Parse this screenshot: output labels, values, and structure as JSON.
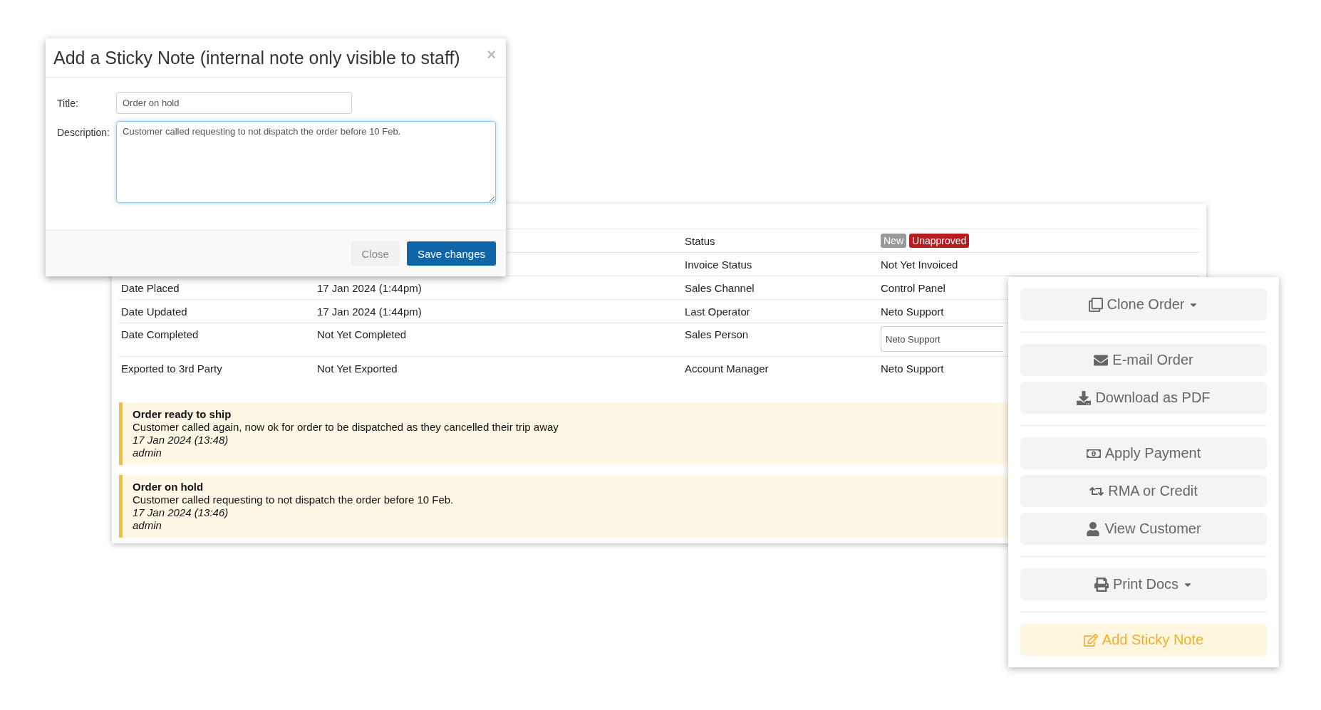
{
  "order_details": {
    "rows": [
      {
        "label_2": "Status",
        "badges": [
          {
            "text": "New",
            "color": "#999999"
          },
          {
            "text": "Unapproved",
            "color": "#b81c23"
          }
        ]
      },
      {
        "label_2": "Invoice Status",
        "value_2": "Not Yet Invoiced"
      },
      {
        "label_1": "Date Placed",
        "value_1": "17 Jan 2024 (1:44pm)",
        "label_2": "Sales Channel",
        "value_2": "Control Panel"
      },
      {
        "label_1": "Date Updated",
        "value_1": "17 Jan 2024 (1:44pm)",
        "label_2": "Last Operator",
        "value_2": "Neto Support"
      },
      {
        "label_1": "Date Completed",
        "value_1": "Not Yet Completed",
        "label_2": "Sales Person",
        "select": "Neto Support"
      },
      {
        "label_1": "Exported to 3rd Party",
        "value_1": "Not Yet Exported",
        "label_2": "Account Manager",
        "value_2": "Neto Support"
      }
    ],
    "notes": [
      {
        "title": "Order ready to ship",
        "text": "Customer called again, now ok for order to be dispatched as they cancelled their trip away",
        "date": "17 Jan 2024 (13:48)",
        "author": "admin"
      },
      {
        "title": "Order on hold",
        "text": "Customer called requesting to not dispatch the order before 10 Feb.",
        "date": "17 Jan 2024 (13:46)",
        "author": "admin"
      }
    ]
  },
  "actions": [
    [
      {
        "label": "Clone Order",
        "dropdown": true,
        "kind": "default"
      }
    ],
    [
      {
        "label": "E-mail Order",
        "dropdown": false,
        "kind": "default"
      },
      {
        "label": "Download as PDF",
        "dropdown": false,
        "kind": "default"
      }
    ],
    [
      {
        "label": "Apply Payment",
        "dropdown": false,
        "kind": "default"
      },
      {
        "label": "RMA or Credit",
        "dropdown": false,
        "kind": "default"
      },
      {
        "label": "View Customer",
        "dropdown": false,
        "kind": "default"
      }
    ],
    [
      {
        "label": "Print Docs",
        "dropdown": true,
        "kind": "default"
      }
    ],
    [
      {
        "label": "Add Sticky Note",
        "dropdown": false,
        "kind": "warning"
      }
    ]
  ],
  "modal": {
    "title": "Add a Sticky Note (internal note only visible to staff)",
    "close": "×",
    "fields": [
      {
        "label": "Title:",
        "value": "Order on hold",
        "kind": "input"
      },
      {
        "label": "Description:",
        "value": "Customer called requesting to not dispatch the order before 10 Feb.",
        "kind": "textarea"
      }
    ],
    "buttons": [
      {
        "label": "Close",
        "kind": "secondary"
      },
      {
        "label": "Save changes",
        "kind": "primary"
      }
    ]
  }
}
